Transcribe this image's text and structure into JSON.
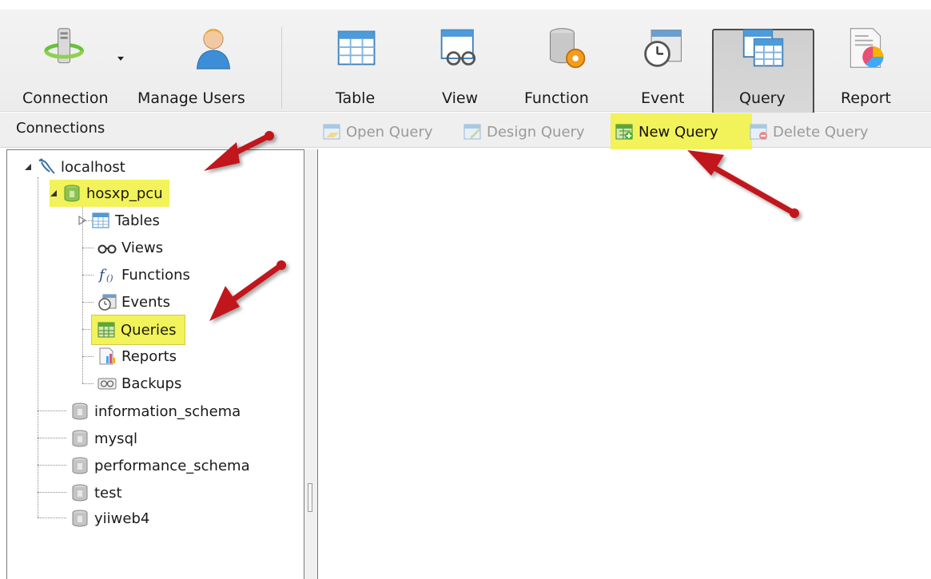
{
  "toolbar": {
    "connection_label": "Connection",
    "manage_users_label": "Manage Users",
    "table_label": "Table",
    "view_label": "View",
    "function_label": "Function",
    "event_label": "Event",
    "query_label": "Query",
    "report_label": "Report"
  },
  "actions": {
    "open_query": "Open Query",
    "design_query": "Design Query",
    "new_query": "New Query",
    "delete_query": "Delete Query"
  },
  "connections_panel": {
    "title": "Connections",
    "tree": {
      "host": "localhost",
      "database": "hosxp_pcu",
      "children": [
        "Tables",
        "Views",
        "Functions",
        "Events",
        "Queries",
        "Reports",
        "Backups"
      ],
      "other_databases": [
        "information_schema",
        "mysql",
        "performance_schema",
        "test",
        "yiiweb4"
      ]
    }
  },
  "colors": {
    "highlight": "#f2f25a",
    "annotation_arrow": "#c0141a"
  }
}
